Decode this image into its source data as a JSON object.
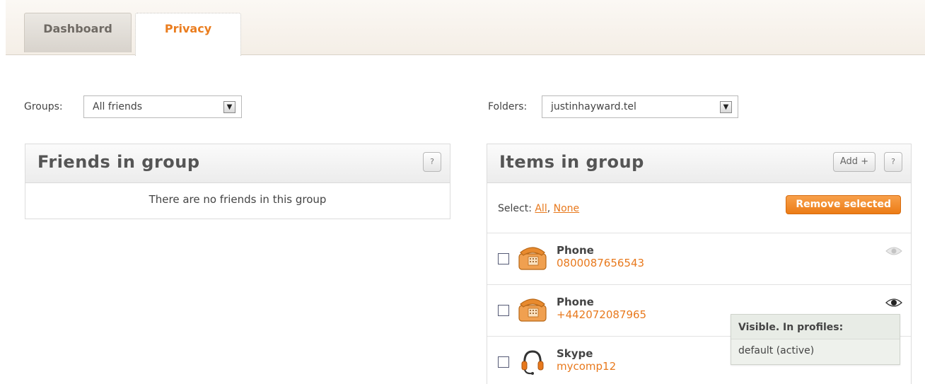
{
  "tabs": [
    {
      "label": "Dashboard",
      "active": false
    },
    {
      "label": "Privacy",
      "active": true
    }
  ],
  "groups": {
    "label": "Groups:",
    "value": "All friends"
  },
  "folders": {
    "label": "Folders:",
    "value": "justinhayward.tel"
  },
  "friends_panel": {
    "title": "Friends in group",
    "help_label": "?",
    "empty_message": "There are no friends in this group"
  },
  "items_panel": {
    "title": "Items in group",
    "add_label": "Add +",
    "help_label": "?",
    "select_label": "Select:",
    "select_all": "All",
    "select_sep": ",",
    "select_none": "None",
    "remove_label": "Remove selected",
    "items": [
      {
        "type": "Phone",
        "value": "0800087656543",
        "icon": "phone-icon",
        "visibility_icon": "eye-icon-faded"
      },
      {
        "type": "Phone",
        "value": "+442072087965",
        "icon": "phone-icon",
        "visibility_icon": "eye-icon"
      },
      {
        "type": "Skype",
        "value": "mycomp12",
        "icon": "headset-icon",
        "visibility_icon": "none"
      }
    ]
  },
  "tooltip": {
    "title": "Visible. In profiles:",
    "body": "default (active)"
  },
  "colors": {
    "accent": "#ea7d1f",
    "button": "#ec7c16",
    "panel_title": "#555555"
  }
}
